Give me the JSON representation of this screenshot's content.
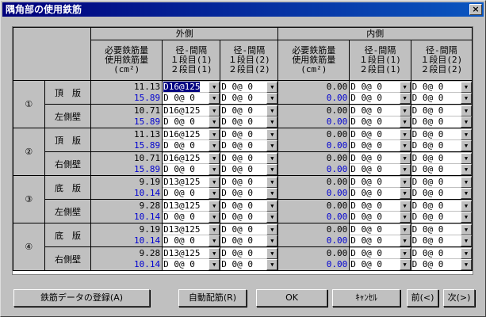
{
  "window": {
    "title": "隅角部の使用鉄筋",
    "close_label": "×"
  },
  "header": {
    "outer_group": "外側",
    "inner_group": "内側",
    "col_amount": [
      "必要鉄筋量",
      "使用鉄筋量",
      "(cm²)"
    ],
    "col_pitch1": [
      "径-間隔",
      "１段目(1)",
      "２段目(1)"
    ],
    "col_pitch2": [
      "径-間隔",
      "１段目(2)",
      "２段目(2)"
    ]
  },
  "groups": [
    {
      "num": "①",
      "rows": [
        {
          "member": "頂　版",
          "out_req": "11.13",
          "out_use": "15.89",
          "out_c1": [
            "D16@125",
            "D 0@   0"
          ],
          "out_c2": [
            "D 0@   0",
            "D 0@   0"
          ],
          "in_req": "0.00",
          "in_use": "0.00",
          "in_c1": [
            "D 0@   0",
            "D 0@   0"
          ],
          "in_c2": [
            "D 0@   0",
            "D 0@   0"
          ]
        },
        {
          "member": "左側壁",
          "out_req": "10.71",
          "out_use": "15.89",
          "out_c1": [
            "D16@125",
            "D 0@   0"
          ],
          "out_c2": [
            "D 0@   0",
            "D 0@   0"
          ],
          "in_req": "0.00",
          "in_use": "0.00",
          "in_c1": [
            "D 0@   0",
            "D 0@   0"
          ],
          "in_c2": [
            "D 0@   0",
            "D 0@   0"
          ]
        }
      ]
    },
    {
      "num": "②",
      "rows": [
        {
          "member": "頂　版",
          "out_req": "11.13",
          "out_use": "15.89",
          "out_c1": [
            "D16@125",
            "D 0@   0"
          ],
          "out_c2": [
            "D 0@   0",
            "D 0@   0"
          ],
          "in_req": "0.00",
          "in_use": "0.00",
          "in_c1": [
            "D 0@   0",
            "D 0@   0"
          ],
          "in_c2": [
            "D 0@   0",
            "D 0@   0"
          ]
        },
        {
          "member": "右側壁",
          "out_req": "10.71",
          "out_use": "15.89",
          "out_c1": [
            "D16@125",
            "D 0@   0"
          ],
          "out_c2": [
            "D 0@   0",
            "D 0@   0"
          ],
          "in_req": "0.00",
          "in_use": "0.00",
          "in_c1": [
            "D 0@   0",
            "D 0@   0"
          ],
          "in_c2": [
            "D 0@   0",
            "D 0@   0"
          ]
        }
      ]
    },
    {
      "num": "③",
      "rows": [
        {
          "member": "底　版",
          "out_req": "9.19",
          "out_use": "10.14",
          "out_c1": [
            "D13@125",
            "D 0@   0"
          ],
          "out_c2": [
            "D 0@   0",
            "D 0@   0"
          ],
          "in_req": "0.00",
          "in_use": "0.00",
          "in_c1": [
            "D 0@   0",
            "D 0@   0"
          ],
          "in_c2": [
            "D 0@   0",
            "D 0@   0"
          ]
        },
        {
          "member": "左側壁",
          "out_req": "9.28",
          "out_use": "10.14",
          "out_c1": [
            "D13@125",
            "D 0@   0"
          ],
          "out_c2": [
            "D 0@   0",
            "D 0@   0"
          ],
          "in_req": "0.00",
          "in_use": "0.00",
          "in_c1": [
            "D 0@   0",
            "D 0@   0"
          ],
          "in_c2": [
            "D 0@   0",
            "D 0@   0"
          ]
        }
      ]
    },
    {
      "num": "④",
      "rows": [
        {
          "member": "底　版",
          "out_req": "9.19",
          "out_use": "10.14",
          "out_c1": [
            "D13@125",
            "D 0@   0"
          ],
          "out_c2": [
            "D 0@   0",
            "D 0@   0"
          ],
          "in_req": "0.00",
          "in_use": "0.00",
          "in_c1": [
            "D 0@   0",
            "D 0@   0"
          ],
          "in_c2": [
            "D 0@   0",
            "D 0@   0"
          ]
        },
        {
          "member": "右側壁",
          "out_req": "9.28",
          "out_use": "10.14",
          "out_c1": [
            "D13@125",
            "D 0@   0"
          ],
          "out_c2": [
            "D 0@   0",
            "D 0@   0"
          ],
          "in_req": "0.00",
          "in_use": "0.00",
          "in_c1": [
            "D 0@   0",
            "D 0@   0"
          ],
          "in_c2": [
            "D 0@   0",
            "D 0@   0"
          ]
        }
      ]
    }
  ],
  "buttons": {
    "register": "鉄筋データの登録(A)",
    "auto": "自動配筋(R)",
    "ok": "OK",
    "cancel": "ｷｬﾝｾﾙ",
    "prev": "前(<)",
    "next": "次(>)"
  },
  "colors": {
    "used_amount": "#0000d0",
    "selected": "#000080"
  },
  "icons": {
    "dropdown": "down-triangle-icon"
  }
}
